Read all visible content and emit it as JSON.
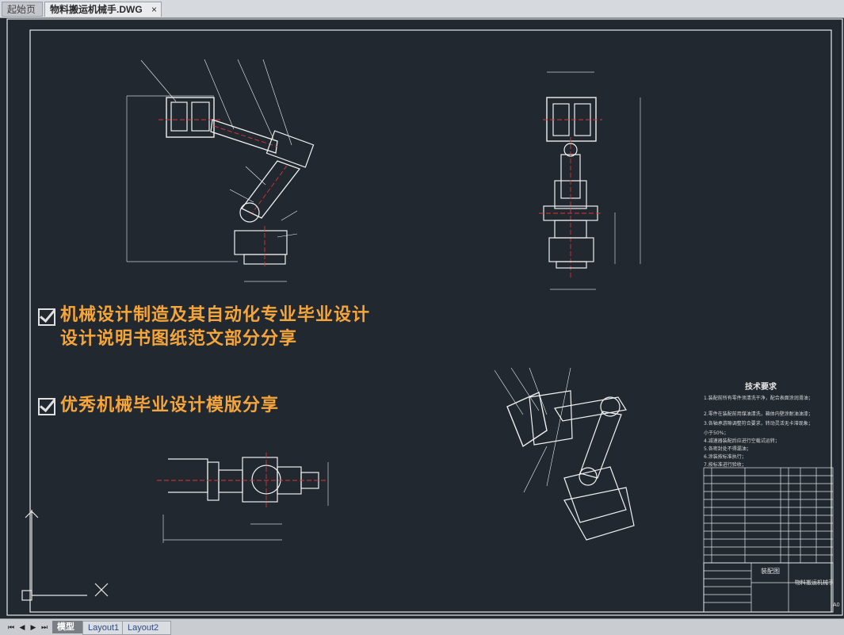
{
  "tabs": {
    "start_label": "起始页",
    "file_label": "物料搬运机械手.DWG",
    "close_glyph": "×"
  },
  "overlay": {
    "bullet1_line1": "机械设计制造及其自动化专业毕业设计",
    "bullet1_line2": "设计说明书图纸范文部分分享",
    "bullet2": "优秀机械毕业设计模版分享",
    "accent_color": "#f5a53a"
  },
  "drawing": {
    "tech_title": "技术要求",
    "tech_lines": [
      "1.装配前所有零件须清洗干净，配合表面涂润滑油；",
      "2.零件在装配前用煤油清洗，箱体内壁涂耐油油漆；",
      "3.各轴承游隙调整符合要求，转动灵活无卡滞现象；",
      "小于50%；",
      "4.减速器装配后应进行空载试运转；",
      "5.各密封处不得漏油；",
      "6.涂装按标准执行；",
      "7.按标准进行验收；"
    ],
    "title_block_name": "装配图",
    "title_block_product": "物料搬运机械手",
    "sheet_size": "A0"
  },
  "layout_tabs": {
    "model": "模型",
    "layout1": "Layout1",
    "layout2": "Layout2"
  },
  "nav": {
    "first": "⏮",
    "prev": "◀",
    "next": "▶",
    "last": "⏭"
  }
}
